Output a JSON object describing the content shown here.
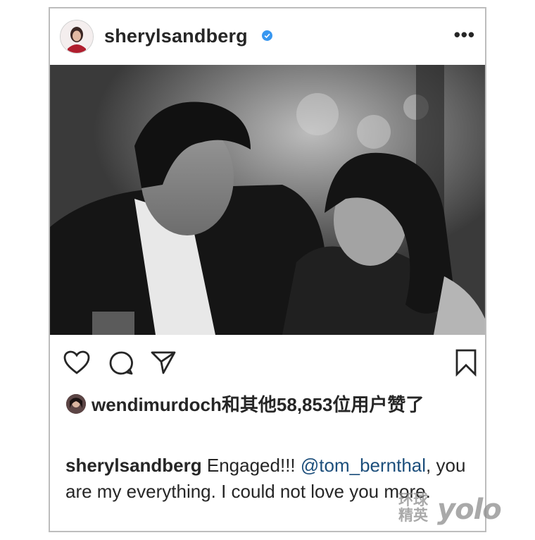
{
  "post": {
    "username": "sherylsandberg",
    "more_label": "•••",
    "likes": {
      "liker": "wendimurdoch",
      "text": "和其他58,853位用户赞了"
    },
    "caption": {
      "username": "sherylsandberg",
      "text_before": " Engaged!!! ",
      "mention": "@tom_bernthal",
      "text_after": ", you are my everything. I could not love you more."
    }
  },
  "watermark": {
    "cn": "环球精英",
    "en": "yolo"
  },
  "icons": [
    "verified-badge-icon",
    "more-options-icon",
    "heart-icon",
    "comment-icon",
    "share-icon",
    "bookmark-icon"
  ],
  "colors": {
    "verified": "#3897f0",
    "mention": "#1d4f7c",
    "text": "#262626"
  }
}
